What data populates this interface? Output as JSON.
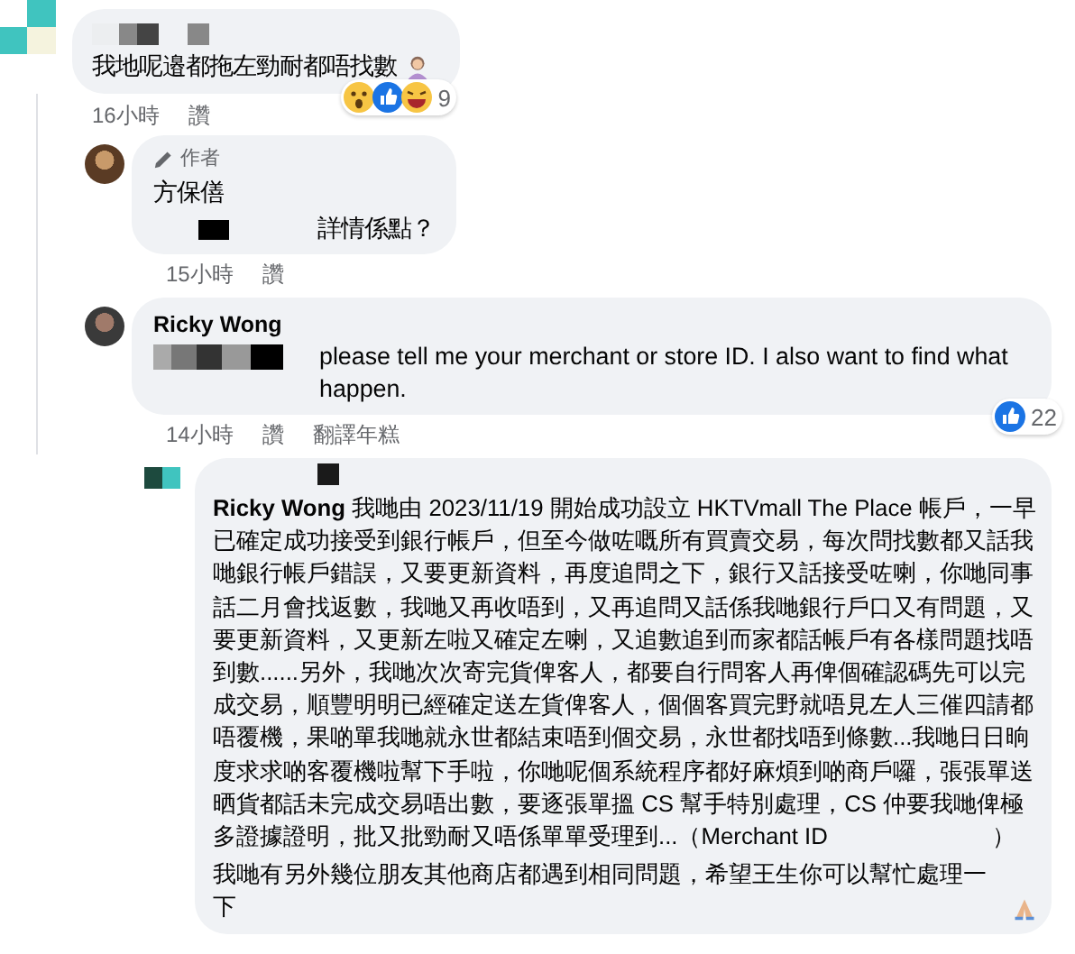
{
  "comments": [
    {
      "kind": "comment",
      "text": "我地呢邉都拖左勁耐都唔找數",
      "reaction_count": "9",
      "time": "16小時",
      "actions": [
        "讚"
      ]
    },
    {
      "kind": "author_reply",
      "badge": "作者",
      "author": "方保僐",
      "text": "詳情係點？",
      "time": "15小時",
      "actions": [
        "讚"
      ]
    },
    {
      "kind": "reply",
      "author": "Ricky Wong",
      "text": "please tell me your merchant or store ID. I also want to find what happen.",
      "reaction_count": "22",
      "time": "14小時",
      "actions": [
        "讚",
        "翻譯年糕"
      ]
    },
    {
      "kind": "long_reply",
      "paragraphs": [
        "**Ricky Wong** 我哋由 2023/11/19 開始成功設立 HKTVmall The Place 帳戶，一早已確定成功接受到銀行帳戶，但至今做咗嘅所有買賣交易，每次問找數都又話我哋銀行帳戶錯誤，又要更新資料，再度追問之下，銀行又話接受咗喇，你哋同事話二月會找返數，我哋又再收唔到，又再追問又話係我哋銀行戶口又有問題，又要更新資料，又更新左啦又確定左喇，又追數追到而家都話帳戶有各樣問題找唔到數......另外，我哋次次寄完貨俾客人，都要自行問客人再俾個確認碼先可以完成交易，順豐明明已經確定送左貨俾客人，個個客買完野就唔見左人三催四請都唔覆機，果啲單我哋就永世都結束唔到個交易，永世都找唔到條數...我哋日日晌度求求啲客覆機啦幫下手啦，你哋呢個系統程序都好麻煩到啲商戶囉，張張單送晒貨都話未完成交易唔出數，要逐張單搵 CS 幫手特別處理，CS 仲要我哋俾極多證據證明，批又批勁耐又唔係單單受理到...（Merchant ID　　　　　　　）",
        "我哋有另外幾位朋友其他商店都遇到相同問題，希望王生你可以幫忙處理一下"
      ]
    }
  ]
}
